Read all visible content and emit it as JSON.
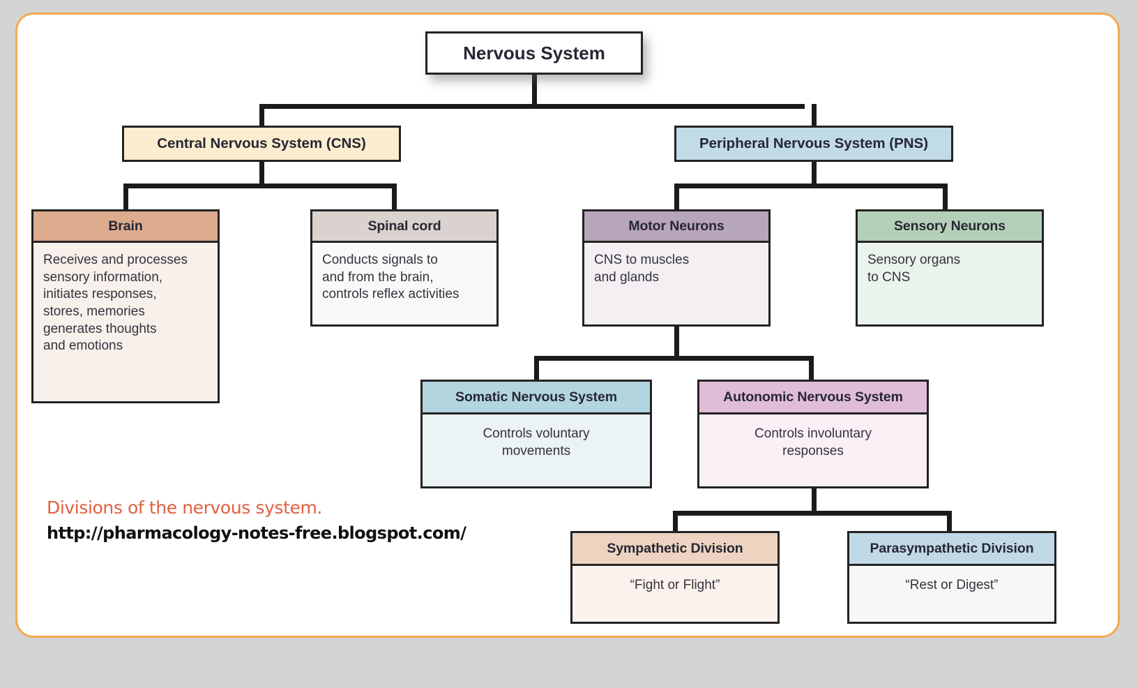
{
  "frame": {
    "border_color": "#f6a94c",
    "page_background": "#d4d4d4",
    "card_background": "#ffffff"
  },
  "diagram": {
    "type": "hierarchy-tree",
    "root": {
      "label": "Nervous System",
      "fill": "#ffffff"
    },
    "level1": [
      {
        "label": "Central Nervous System (CNS)",
        "fill": "#fcedd0"
      },
      {
        "label": "Peripheral Nervous System (PNS)",
        "fill": "#c2dbe8"
      }
    ],
    "level2": [
      {
        "title": "Brain",
        "header_fill": "#ddab8e",
        "body_fill": "#f8f1eb",
        "body": "Receives and processes sensory information, initiates responses, stores, memories generates thoughts and emotions",
        "body_lines": [
          "Receives and processes",
          "sensory information,",
          "initiates responses,",
          "stores, memories",
          "generates thoughts",
          "and emotions"
        ]
      },
      {
        "title": "Spinal cord",
        "header_fill": "#dad2ce",
        "body_fill": "#faf9f9",
        "body": "Conducts signals to and from the brain, controls reflex activities",
        "body_lines": [
          "Conducts signals to",
          "and from the brain,",
          "controls reflex activities"
        ]
      },
      {
        "title": "Motor Neurons",
        "header_fill": "#b7a5b9",
        "body_fill": "#f3eff3",
        "body": "CNS to muscles and glands",
        "body_lines": [
          "CNS to muscles",
          "and glands"
        ]
      },
      {
        "title": "Sensory Neurons",
        "header_fill": "#b5d0b9",
        "body_fill": "#ebf3ed",
        "body": "Sensory organs to CNS",
        "body_lines": [
          "Sensory organs",
          "to CNS"
        ]
      }
    ],
    "level3": [
      {
        "title": "Somatic Nervous System",
        "header_fill": "#b3d5df",
        "body_fill": "#ebf3f5",
        "body": "Controls voluntary movements",
        "body_lines": [
          "Controls voluntary",
          "movements"
        ]
      },
      {
        "title": "Autonomic Nervous System",
        "header_fill": "#e0bdd6",
        "body_fill": "#faf0f6",
        "body": "Controls involuntary responses",
        "body_lines": [
          "Controls involuntary",
          "responses"
        ]
      }
    ],
    "level4": [
      {
        "title": "Sympathetic Division",
        "header_fill": "#eed4c0",
        "body_fill": "#fcf2ed",
        "body": "“Fight or Flight”"
      },
      {
        "title": "Parasympathetic Division",
        "header_fill": "#c1d9e7",
        "body_fill": "#f8f7f8",
        "body": "“Rest or Digest”"
      }
    ]
  },
  "caption": {
    "title": "Divisions of the nervous system.",
    "title_color": "#e0603f",
    "url": "http://pharmacology-notes-free.blogspot.com/"
  }
}
